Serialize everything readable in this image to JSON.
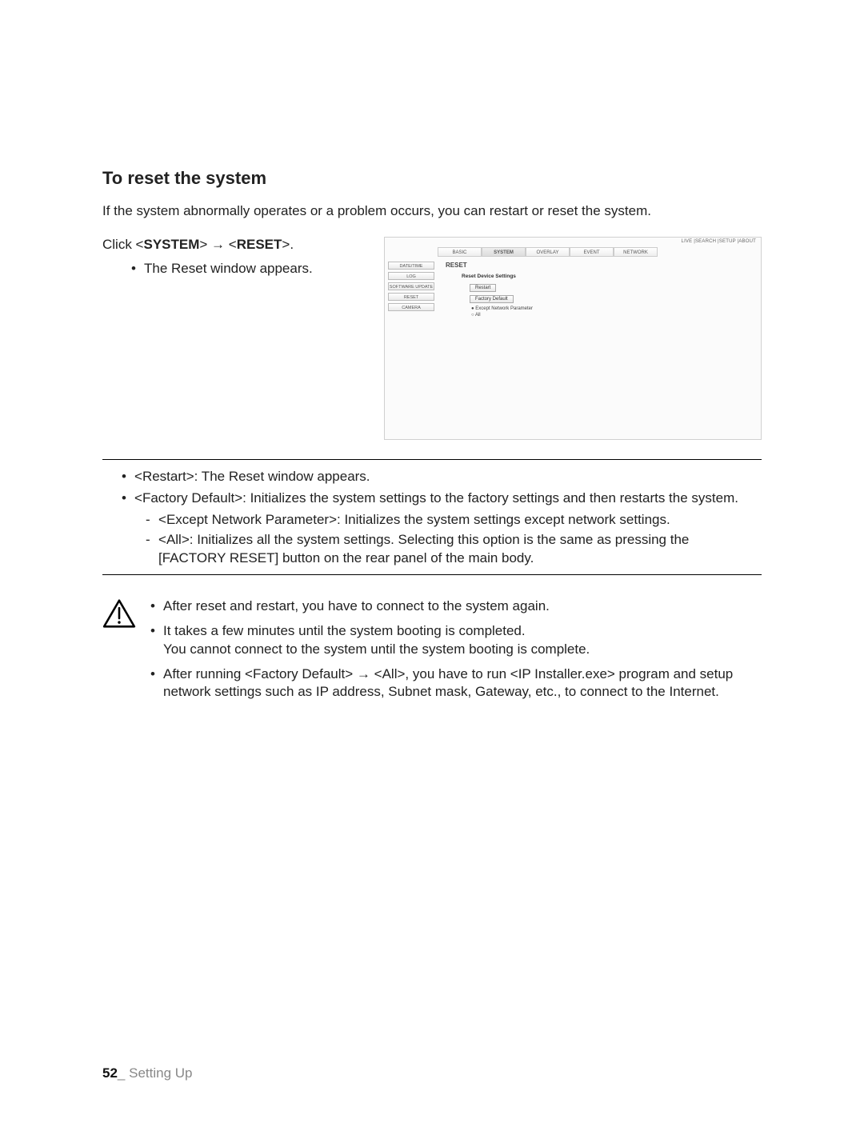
{
  "heading": "To reset the system",
  "intro": "If the system abnormally operates or a problem occurs, you can restart or reset the system.",
  "click_line": {
    "prefix": "Click <",
    "system": "SYSTEM",
    "mid": "> → <",
    "reset": "RESET",
    "suffix": ">."
  },
  "first_bullet": "The Reset window appears.",
  "screenshot": {
    "top_links": "LIVE  |SEARCH |SETUP  |ABOUT",
    "tabs": [
      "BASIC",
      "SYSTEM",
      "OVERLAY",
      "EVENT",
      "NETWORK"
    ],
    "active_tab_index": 1,
    "side": [
      "DATE/TIME",
      "LOG",
      "SOFTWARE UPDATE",
      "RESET",
      "CAMERA"
    ],
    "panel_title": "RESET",
    "panel_sub": "Reset Device Settings",
    "btn_restart": "Restart",
    "btn_factory": "Factory Default",
    "radio_except": "Except Network Parameter",
    "radio_all": "All"
  },
  "desc": {
    "restart_label": "Restart",
    "restart_text": ": The Reset window appears.",
    "factory_label": "Factory Default",
    "factory_text": ": Initializes the system settings to the factory settings and then restarts the system.",
    "except_label": "Except Network Parameter",
    "except_text": ": Initializes the system settings except network settings.",
    "all_label": "All",
    "all_text_a": ": Initializes all the system settings. Selecting this option is the same as pressing the",
    "all_text_b_label": "FACTORY RESET",
    "all_text_b_suffix": "] button on the rear panel of the main body."
  },
  "warn": {
    "w1": "After reset and restart, you have to connect to the system again.",
    "w2a": "It takes a few minutes until the system booting is completed.",
    "w2b": "You cannot connect to the system until the system booting is complete.",
    "w3_pre": "After running <",
    "w3_fd": "Factory Default",
    "w3_mid1": "> → <",
    "w3_all": "All",
    "w3_mid2": ">, you have to run <",
    "w3_ip": "IP Installer.exe",
    "w3_post": "> program and setup network settings such as IP address, Subnet mask, Gateway, etc., to connect to the Internet."
  },
  "footer": {
    "page": "52",
    "sep": "_ ",
    "section": "Setting Up"
  }
}
